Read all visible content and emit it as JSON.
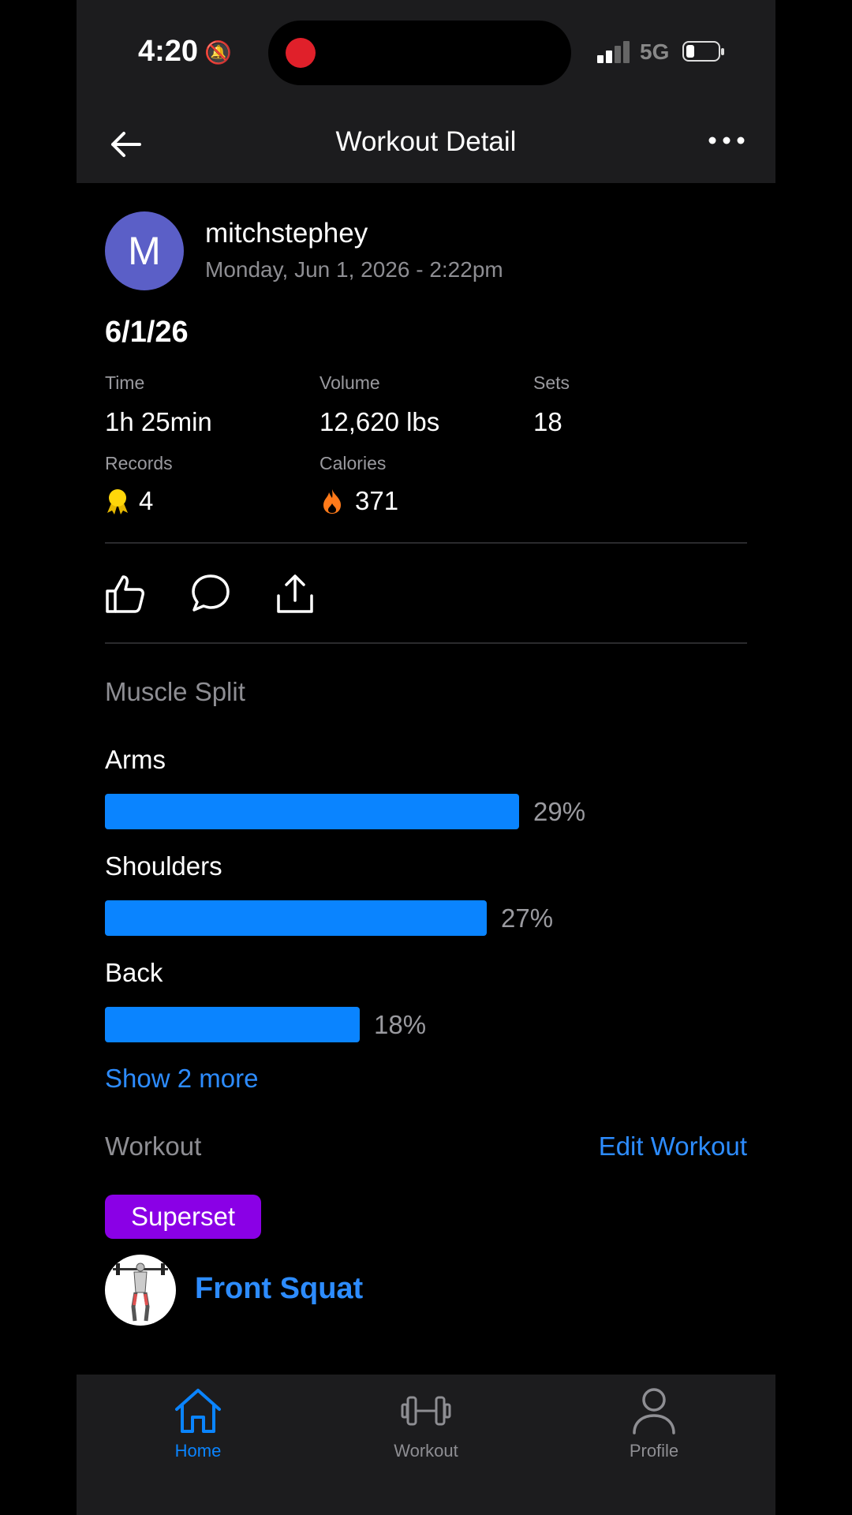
{
  "status_bar": {
    "time": "4:20",
    "network": "5G"
  },
  "nav": {
    "title": "Workout Detail"
  },
  "user": {
    "avatar_initial": "M",
    "username": "mitchstephey",
    "datetime": "Monday, Jun 1, 2026 - 2:22pm"
  },
  "workout": {
    "title": "6/1/26"
  },
  "stats": {
    "time_label": "Time",
    "time_value": "1h 25min",
    "volume_label": "Volume",
    "volume_value": "12,620 lbs",
    "sets_label": "Sets",
    "sets_value": "18",
    "records_label": "Records",
    "records_value": "4",
    "calories_label": "Calories",
    "calories_value": "371"
  },
  "muscle_split": {
    "section_label": "Muscle Split",
    "items": [
      {
        "name": "Arms",
        "percent_label": "29%",
        "fill_fraction": 0.645
      },
      {
        "name": "Shoulders",
        "percent_label": "27%",
        "fill_fraction": 0.595
      },
      {
        "name": "Back",
        "percent_label": "18%",
        "fill_fraction": 0.397
      }
    ],
    "show_more": "Show 2 more"
  },
  "workout_section": {
    "label": "Workout",
    "edit_link": "Edit Workout",
    "superset_badge": "Superset",
    "exercise_name": "Front Squat"
  },
  "tabs": [
    {
      "label": "Home",
      "icon": "home-icon",
      "active": true
    },
    {
      "label": "Workout",
      "icon": "dumbbell-icon",
      "active": false
    },
    {
      "label": "Profile",
      "icon": "person-icon",
      "active": false
    }
  ],
  "colors": {
    "accent": "#0a84ff",
    "link": "#2d8cff",
    "superset": "#8a00e6",
    "avatar": "#5b5fc7"
  }
}
